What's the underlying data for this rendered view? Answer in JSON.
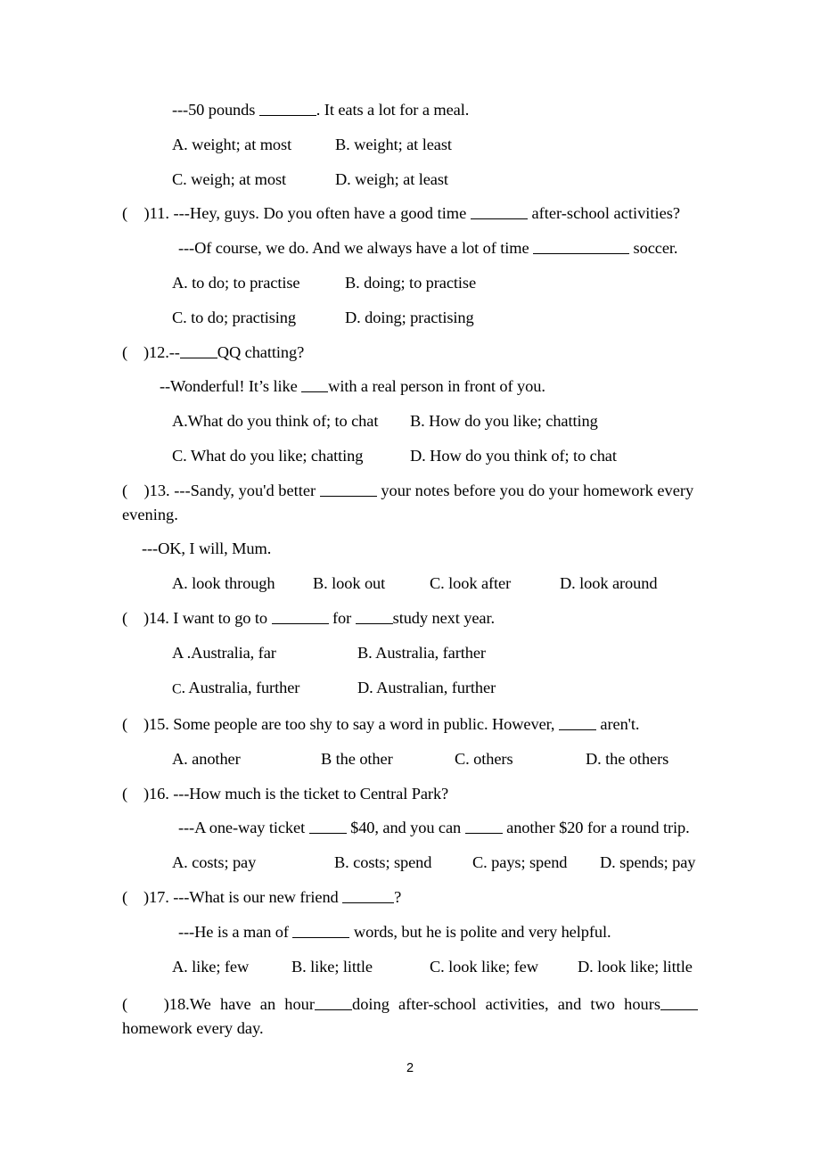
{
  "document": {
    "page_number": "2",
    "lines": {
      "q10_stem_cont": "---50 pounds ______. It eats a lot for a meal.",
      "q10_stem_pre": "---50 pounds ",
      "q10_stem_post": ". It eats a lot for a meal.",
      "q10_optA": "A. weight; at most",
      "q10_optB": "B. weight; at least",
      "q10_optC": "C. weigh; at most",
      "q10_optD": "D. weigh; at least",
      "q11_marker": "(    )11. ",
      "q11_stem_pre": "---Hey, guys. Do you often have a good time ",
      "q11_stem_post": " after-school activities?",
      "q11_reply_pre": "---Of course, we do. And we always have a lot of time ",
      "q11_reply_post": " soccer.",
      "q11_optA": "A. to do; to practise",
      "q11_optB": "B. doing; to practise",
      "q11_optC": "C. to do; practising",
      "q11_optD": "D. doing; practising",
      "q12_marker": "(    )12.--",
      "q12_stem_post": "QQ chatting?",
      "q12_reply_pre": "--Wonderful! It’s like ",
      "q12_reply_post": "with a real person in front of you.",
      "q12_optA": "A.What do you think of; to chat",
      "q12_optB": "B. How do you like; chatting",
      "q12_optC": "C. What do you like; chatting",
      "q12_optD": "D. How do you think of; to chat",
      "q13_marker": "(    )13. ",
      "q13_stem_pre": "---Sandy, you'd better ",
      "q13_stem_post": " your notes before you do your homework every evening.",
      "q13_reply": "---OK, I will, Mum.",
      "q13_optA": "A. look through",
      "q13_optB": "B. look out",
      "q13_optC": "C. look after",
      "q13_optD": "D. look around",
      "q14_marker": "(    )14. ",
      "q14_stem_pre": "I want to go to ",
      "q14_stem_mid": " for ",
      "q14_stem_post": "study next year.",
      "q14_optA": "A .Australia, far",
      "q14_optB": "B. Australia, farther",
      "q14_optC_prefix": "C",
      "q14_optC_rest": ". Australia, further",
      "q14_optD": "D. Australian, further",
      "q15_marker": "(    )15. ",
      "q15_stem_pre": "Some people are too shy to say a word in public. However, ",
      "q15_stem_post": " aren't.",
      "q15_optA": "A. another",
      "q15_optB": "B the other",
      "q15_optC": "C. others",
      "q15_optD": "D. the others",
      "q16_marker": "(    )16. ",
      "q16_stem": "---How much is the ticket to Central Park?",
      "q16_reply_pre": "---A one-way ticket ",
      "q16_reply_mid": " $40, and you can ",
      "q16_reply_post": " another $20 for a round trip.",
      "q16_optA": "A. costs; pay",
      "q16_optB": "B. costs; spend",
      "q16_optC": "C. pays; spend",
      "q16_optD": "D. spends; pay",
      "q17_marker": "(    )17. ",
      "q17_stem_pre": "---What is our new friend ",
      "q17_stem_post": "?",
      "q17_reply_pre": "---He is a man of ",
      "q17_reply_post": " words, but he is polite and very helpful.",
      "q17_optA": "A. like; few",
      "q17_optB": "B. like; little",
      "q17_optC": "C. look like; few",
      "q17_optD": "D. look like; little",
      "q18_marker": "(    )18.",
      "q18_stem_pre": "We have an hour",
      "q18_stem_mid": "doing after-school activities, and two hours",
      "q18_stem_post": "homework every day."
    }
  }
}
